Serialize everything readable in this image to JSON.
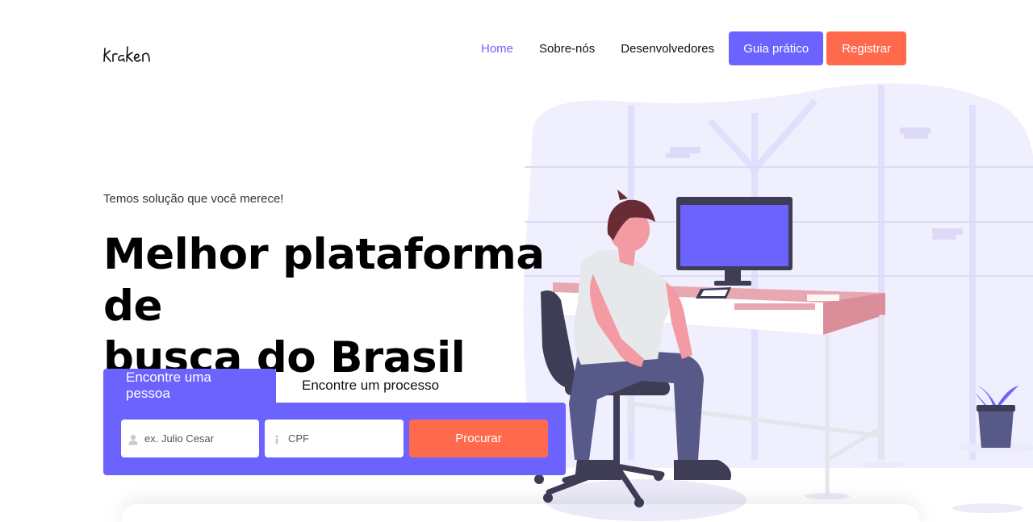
{
  "brand": {
    "logo_text": "kraken"
  },
  "nav": {
    "links": [
      {
        "label": "Home",
        "active": true
      },
      {
        "label": "Sobre-nós",
        "active": false
      },
      {
        "label": "Desenvolvedores",
        "active": false
      }
    ],
    "guide_label": "Guia prático",
    "register_label": "Registrar"
  },
  "hero": {
    "tagline": "Temos solução que você merece!",
    "headline_line1": "Melhor plataforma de",
    "headline_line2": "busca do Brasil"
  },
  "search": {
    "tabs": [
      {
        "label": "Encontre uma pessoa",
        "active": true
      },
      {
        "label": "Encontre um processo",
        "active": false
      }
    ],
    "name_placeholder": "ex. Julio Cesar",
    "cpf_placeholder": "CPF",
    "submit_label": "Procurar",
    "name_icon": "user-icon",
    "cpf_icon": "info-icon"
  },
  "colors": {
    "accent": "#6c63ff",
    "cta": "#ff6a4d"
  }
}
